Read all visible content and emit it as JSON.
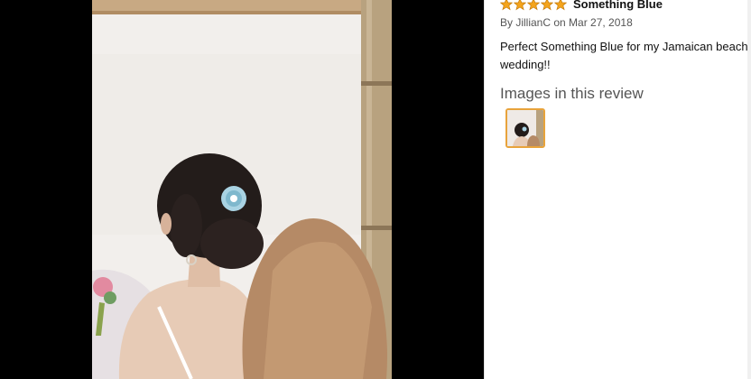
{
  "review": {
    "rating": 5,
    "title": "Something Blue",
    "byline": "By JillianC on Mar 27, 2018",
    "body": "Perfect Something Blue for my Jamaican beach wedding!!",
    "images_heading": "Images in this review"
  },
  "icons": {
    "star": "star-icon"
  },
  "colors": {
    "star_fill": "#f4a41c",
    "star_stroke": "#c57b0c",
    "thumb_border": "#e8a33b"
  }
}
